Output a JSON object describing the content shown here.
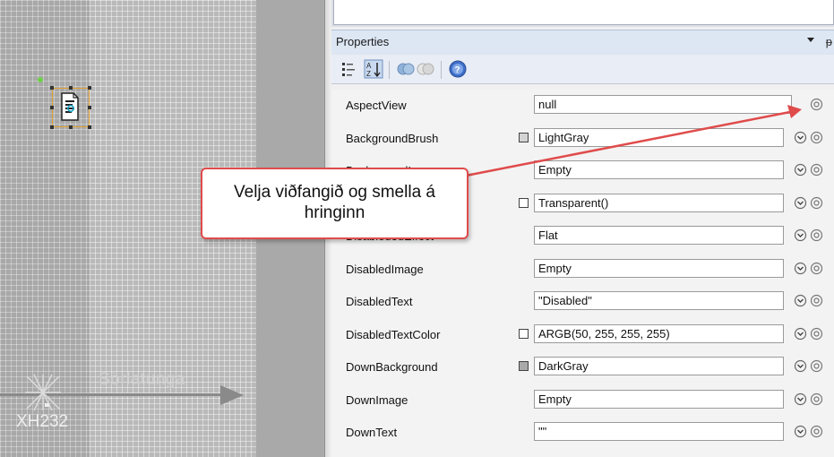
{
  "canvas": {
    "road_label": "Sörlatunga",
    "node_label": "XH232"
  },
  "properties": {
    "title": "Properties",
    "pin_glyph": "ᵽ",
    "toolbar": [
      {
        "icon": "categorized-icon"
      },
      {
        "icon": "alphabetical-sort-icon"
      },
      {
        "icon": "properties-view-icon"
      },
      {
        "icon": "events-view-icon"
      },
      {
        "icon": "help-icon"
      }
    ],
    "rows": [
      {
        "name": "AspectView",
        "value": "null",
        "swatch": null,
        "chevron": false
      },
      {
        "name": "BackgroundBrush",
        "value": "LightGray",
        "swatch": "#d3d3d3",
        "chevron": true
      },
      {
        "name": "BackgroundImage",
        "value": "Empty",
        "swatch": null,
        "chevron": true
      },
      {
        "name": "DisabledBackground",
        "value": "Transparent()",
        "swatch": "#ffffff",
        "chevron": true
      },
      {
        "name": "Disabled3dEffect",
        "value": "Flat",
        "swatch": null,
        "chevron": true
      },
      {
        "name": "DisabledImage",
        "value": "Empty",
        "swatch": null,
        "chevron": true
      },
      {
        "name": "DisabledText",
        "value": "\"Disabled\"",
        "swatch": null,
        "chevron": true
      },
      {
        "name": "DisabledTextColor",
        "value": "ARGB(50, 255, 255, 255)",
        "swatch": "#ffffff",
        "chevron": true
      },
      {
        "name": "DownBackground",
        "value": "DarkGray",
        "swatch": "#a9a9a9",
        "chevron": true
      },
      {
        "name": "DownImage",
        "value": "Empty",
        "swatch": null,
        "chevron": true
      },
      {
        "name": "DownText",
        "value": "\"\"",
        "swatch": null,
        "chevron": true
      }
    ]
  },
  "callout": {
    "text": "Velja viðfangið og smella á hringinn",
    "border_color": "#e04b4b"
  }
}
